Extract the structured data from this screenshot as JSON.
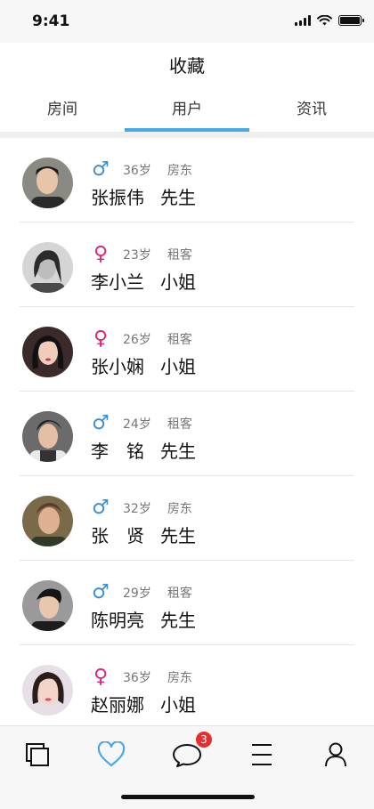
{
  "status_bar": {
    "time": "9:41"
  },
  "header": {
    "title": "收藏"
  },
  "tabs": [
    {
      "label": "房间",
      "active": false
    },
    {
      "label": "用户",
      "active": true
    },
    {
      "label": "资讯",
      "active": false
    }
  ],
  "users": [
    {
      "gender": "male",
      "gender_symbol": "♂",
      "age": "36岁",
      "role": "房东",
      "name": "张振伟",
      "title": "先生"
    },
    {
      "gender": "female",
      "gender_symbol": "♀",
      "age": "23岁",
      "role": "租客",
      "name": "李小兰",
      "title": "小姐"
    },
    {
      "gender": "female",
      "gender_symbol": "♀",
      "age": "26岁",
      "role": "租客",
      "name": "张小娴",
      "title": "小姐"
    },
    {
      "gender": "male",
      "gender_symbol": "♂",
      "age": "24岁",
      "role": "租客",
      "name": "李　铭",
      "title": "先生"
    },
    {
      "gender": "male",
      "gender_symbol": "♂",
      "age": "32岁",
      "role": "房东",
      "name": "张　贤",
      "title": "先生"
    },
    {
      "gender": "male",
      "gender_symbol": "♂",
      "age": "29岁",
      "role": "租客",
      "name": "陈明亮",
      "title": "先生"
    },
    {
      "gender": "female",
      "gender_symbol": "♀",
      "age": "36岁",
      "role": "房东",
      "name": "赵丽娜",
      "title": "小姐"
    }
  ],
  "tabbar": {
    "items": [
      {
        "icon": "copy-icon",
        "active": false
      },
      {
        "icon": "heart-icon",
        "active": true
      },
      {
        "icon": "chat-icon",
        "active": false,
        "badge": "3"
      },
      {
        "icon": "menu-icon",
        "active": false
      },
      {
        "icon": "user-icon",
        "active": false
      }
    ]
  },
  "colors": {
    "accent": "#45a8e8",
    "male": "#3a8fd6",
    "female": "#e0247c",
    "badge": "#e62e2e"
  }
}
